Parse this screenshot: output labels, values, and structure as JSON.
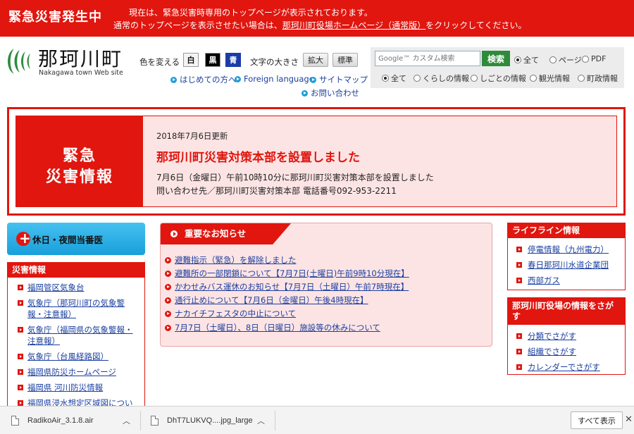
{
  "banner": {
    "title": "緊急災害発生中",
    "line1": "現在は、緊急災害時専用のトップページが表示されております。",
    "line2_pre": "通常のトップページを表示させたい場合は、",
    "line2_link": "那珂川町役場ホームページ（通常版）",
    "line2_post": "をクリックしてください。"
  },
  "header": {
    "logo_jp": "那珂川町",
    "logo_en": "Nakagawa town Web site",
    "color_label": "色を変える",
    "color_white": "白",
    "color_black": "黒",
    "color_blue": "青",
    "size_label": "文字の大きさ",
    "size_big": "拡大",
    "size_std": "標準",
    "links": {
      "first": "はじめての方へ",
      "foreign": "Foreign language",
      "sitemap": "サイトマップ",
      "contact": "お問い合わせ"
    }
  },
  "search": {
    "placeholder": "Google™ カスタム検索",
    "button": "検索",
    "type_options": [
      "全て",
      "ページ",
      "PDF"
    ],
    "category_options": [
      "全て",
      "くらしの情報",
      "しごとの情報",
      "観光情報",
      "町政情報"
    ]
  },
  "emergency": {
    "left1": "緊急",
    "left2": "災害情報",
    "date": "2018年7月6日更新",
    "headline": "那珂川町災害対策本部を設置しました",
    "body1": "7月6日（金曜日）午前10時10分に那珂川町災害対策本部を設置しました",
    "body2": "問い合わせ先／那珂川町災害対策本部 電話番号092-953-2211"
  },
  "holiday_button": "休日・夜間当番医",
  "disaster_info": {
    "title": "災害情報",
    "items": [
      "福岡管区気象台",
      "気象庁（那珂川町の気象警報・注意報）",
      "気象庁（福岡県の気象警報・注意報）",
      "気象庁（台風経路図）",
      "福岡県防災ホームページ",
      "福岡県 河川防災情報",
      "福岡県浸水想定区域図について"
    ]
  },
  "news": {
    "title": "重要なお知らせ",
    "items": [
      "避難指示（緊急）を解除しました",
      "避難所の一部閉鎖について【7月7日(土曜日)午前9時10分現在】",
      "かわせみバス運休のお知らせ【7月7日（土曜日）午前7時現在】",
      "通行止めについて【7月6日（金曜日）午後4時現在】",
      "ナカイチフェスタの中止について",
      "7月7日（土曜日）、8日（日曜日）施設等の休みについて"
    ]
  },
  "lifeline": {
    "title": "ライフライン情報",
    "items": [
      "停電情報（九州電力）",
      "春日那珂川水道企業団",
      "西部ガス"
    ]
  },
  "find": {
    "title": "那珂川町役場の情報をさがす",
    "items": [
      "分類でさがす",
      "組織でさがす",
      "カレンダーでさがす"
    ]
  },
  "downloads": {
    "item1": "RadikoAir_3.1.8.air",
    "item2": "DhT7LUKVQ....jpg_large",
    "show_all": "すべて表示",
    "close": "✕"
  },
  "colors": {
    "emergency_red": "#e0160f",
    "link_blue": "#1b3fa0",
    "panel_pink": "#fde4e4",
    "search_green": "#2e8b3a",
    "holiday_blue": "#199fdb"
  }
}
